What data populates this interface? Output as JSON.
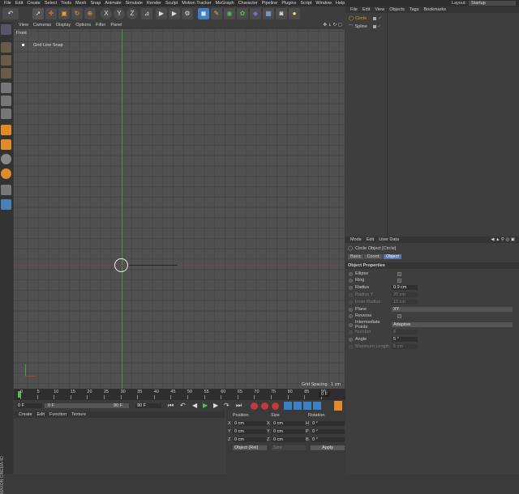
{
  "menu": [
    "File",
    "Edit",
    "Create",
    "Select",
    "Tools",
    "Mesh",
    "Snap",
    "Animate",
    "Simulate",
    "Render",
    "Sculpt",
    "Motion Tracker",
    "MoGraph",
    "Character",
    "Pipeline",
    "Plugins",
    "Script",
    "Window",
    "Help"
  ],
  "layout": {
    "label": "Layout:",
    "value": "Startup"
  },
  "toolbar": {
    "x": "X",
    "y": "Y",
    "z": "Z"
  },
  "viewport": {
    "menu": [
      "View",
      "Cameras",
      "Display",
      "Options",
      "Filter",
      "Panel"
    ],
    "name": "Front",
    "snap_label": "Grid Line Snap",
    "grid_spacing": "Grid Spacing : 1 cm"
  },
  "objects": {
    "menu": [
      "File",
      "Edit",
      "View",
      "Objects",
      "Tags",
      "Bookmarks"
    ],
    "items": [
      {
        "name": "Circle",
        "selected": true
      },
      {
        "name": "Spline",
        "selected": false
      }
    ]
  },
  "attributes": {
    "menu": [
      "Mode",
      "Edit",
      "User Data"
    ],
    "title": "Circle Object [Circle]",
    "tabs": [
      "Basic",
      "Coord.",
      "Object"
    ],
    "active_tab": "Object",
    "section": "Object Properties",
    "props": [
      {
        "label": "Ellipse",
        "type": "check",
        "dim": false
      },
      {
        "label": "Ring",
        "type": "check",
        "dim": false
      },
      {
        "label": "Radius",
        "type": "field",
        "value": "0.9 cm",
        "dim": false
      },
      {
        "label": "Radius Y",
        "type": "field",
        "value": "20 cm",
        "dim": true
      },
      {
        "label": "Inner Radius",
        "type": "field",
        "value": "10 cm",
        "dim": true
      },
      {
        "label": "Plane",
        "type": "select",
        "value": "XY",
        "dim": false
      },
      {
        "label": "Reverse",
        "type": "check",
        "dim": false
      },
      {
        "label": "Intermediate Points",
        "type": "select",
        "value": "Adaptive",
        "dim": false
      },
      {
        "label": "Number",
        "type": "field",
        "value": "8",
        "dim": true
      },
      {
        "label": "Angle",
        "type": "field",
        "value": "5 °",
        "dim": false
      },
      {
        "label": "Maximum Length",
        "type": "field",
        "value": "5 cm",
        "dim": true
      }
    ]
  },
  "timeline": {
    "ticks": [
      "0",
      "5",
      "10",
      "15",
      "20",
      "25",
      "30",
      "35",
      "40",
      "45",
      "50",
      "55",
      "60",
      "65",
      "70",
      "75",
      "80",
      "85",
      "90"
    ],
    "end_frame": "0 F"
  },
  "transport": {
    "current": "0 F",
    "start": "0 F",
    "max": "90 F",
    "end": "90 F"
  },
  "materials": {
    "menu": [
      "Create",
      "Edit",
      "Function",
      "Texture"
    ]
  },
  "coords": {
    "headers": [
      "Position",
      "Size",
      "Rotation"
    ],
    "rows": [
      {
        "axis": "X",
        "pos": "0 cm",
        "size": "0 cm",
        "rlabel": "H",
        "rot": "0 °"
      },
      {
        "axis": "Y",
        "pos": "0 cm",
        "size": "0 cm",
        "rlabel": "P",
        "rot": "0 °"
      },
      {
        "axis": "Z",
        "pos": "0 cm",
        "size": "0 cm",
        "rlabel": "B",
        "rot": "0 °"
      }
    ],
    "mode": "Object (Rel)",
    "size_mode": "Size",
    "apply": "Apply"
  },
  "brand": "MAXON CINEMA 4D",
  "colors": {
    "accent": "#f0a030",
    "selected": "#e8a020",
    "y_axis": "#3da53d",
    "x_axis": "#b43c3c",
    "spline_tag": "#4ec24e"
  }
}
